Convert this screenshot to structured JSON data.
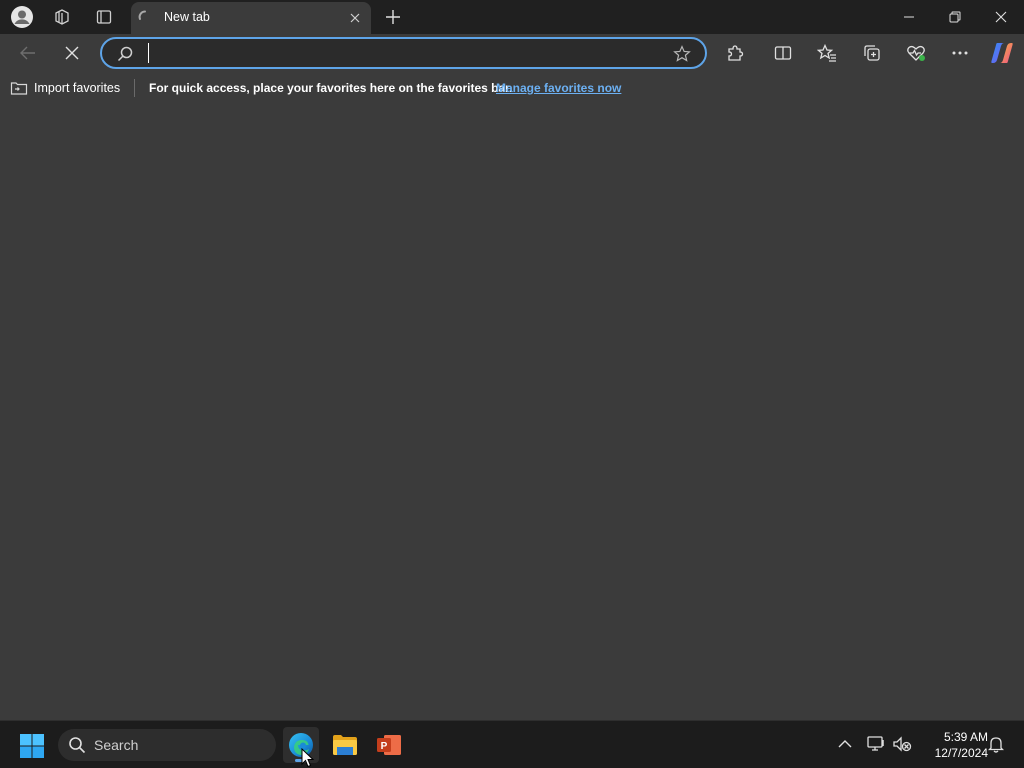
{
  "browser": {
    "tab": {
      "title": "New tab"
    },
    "address_bar": {
      "value": "",
      "placeholder": ""
    }
  },
  "favorites_bar": {
    "import_label": "Import favorites",
    "message": "For quick access, place your favorites here on the favorites bar.",
    "link_label": "Manage favorites now"
  },
  "taskbar": {
    "search_label": "Search",
    "apps": [
      "edge-icon",
      "file-explorer-icon",
      "powerpoint-icon"
    ],
    "clock": {
      "time": "5:39 AM",
      "date": "12/7/2024"
    }
  },
  "colors": {
    "accent": "#5ea4e8",
    "link": "#6cb0f2",
    "page_bg": "#3b3b3b",
    "titlebar_bg": "#202020",
    "taskbar_bg": "#1c1c1c"
  }
}
